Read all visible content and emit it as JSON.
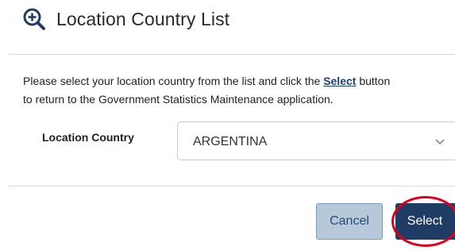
{
  "header": {
    "icon": "zoom-in-icon",
    "title": "Location Country List"
  },
  "instructions": {
    "before_link": "Please select your location country from the list and click the ",
    "link_text": "Select",
    "after_link_line1": " button",
    "line2": "to return to the Government Statistics Maintenance application."
  },
  "form": {
    "label": "Location Country",
    "selected_value": "ARGENTINA",
    "chevron_icon": "chevron-down-icon"
  },
  "buttons": {
    "cancel_label": "Cancel",
    "select_label": "Select"
  },
  "colors": {
    "primary_dark": "#1f3c64",
    "cancel_bg": "#b8c8db",
    "highlight_ring": "#e0001b",
    "link": "#1b3f7a"
  }
}
